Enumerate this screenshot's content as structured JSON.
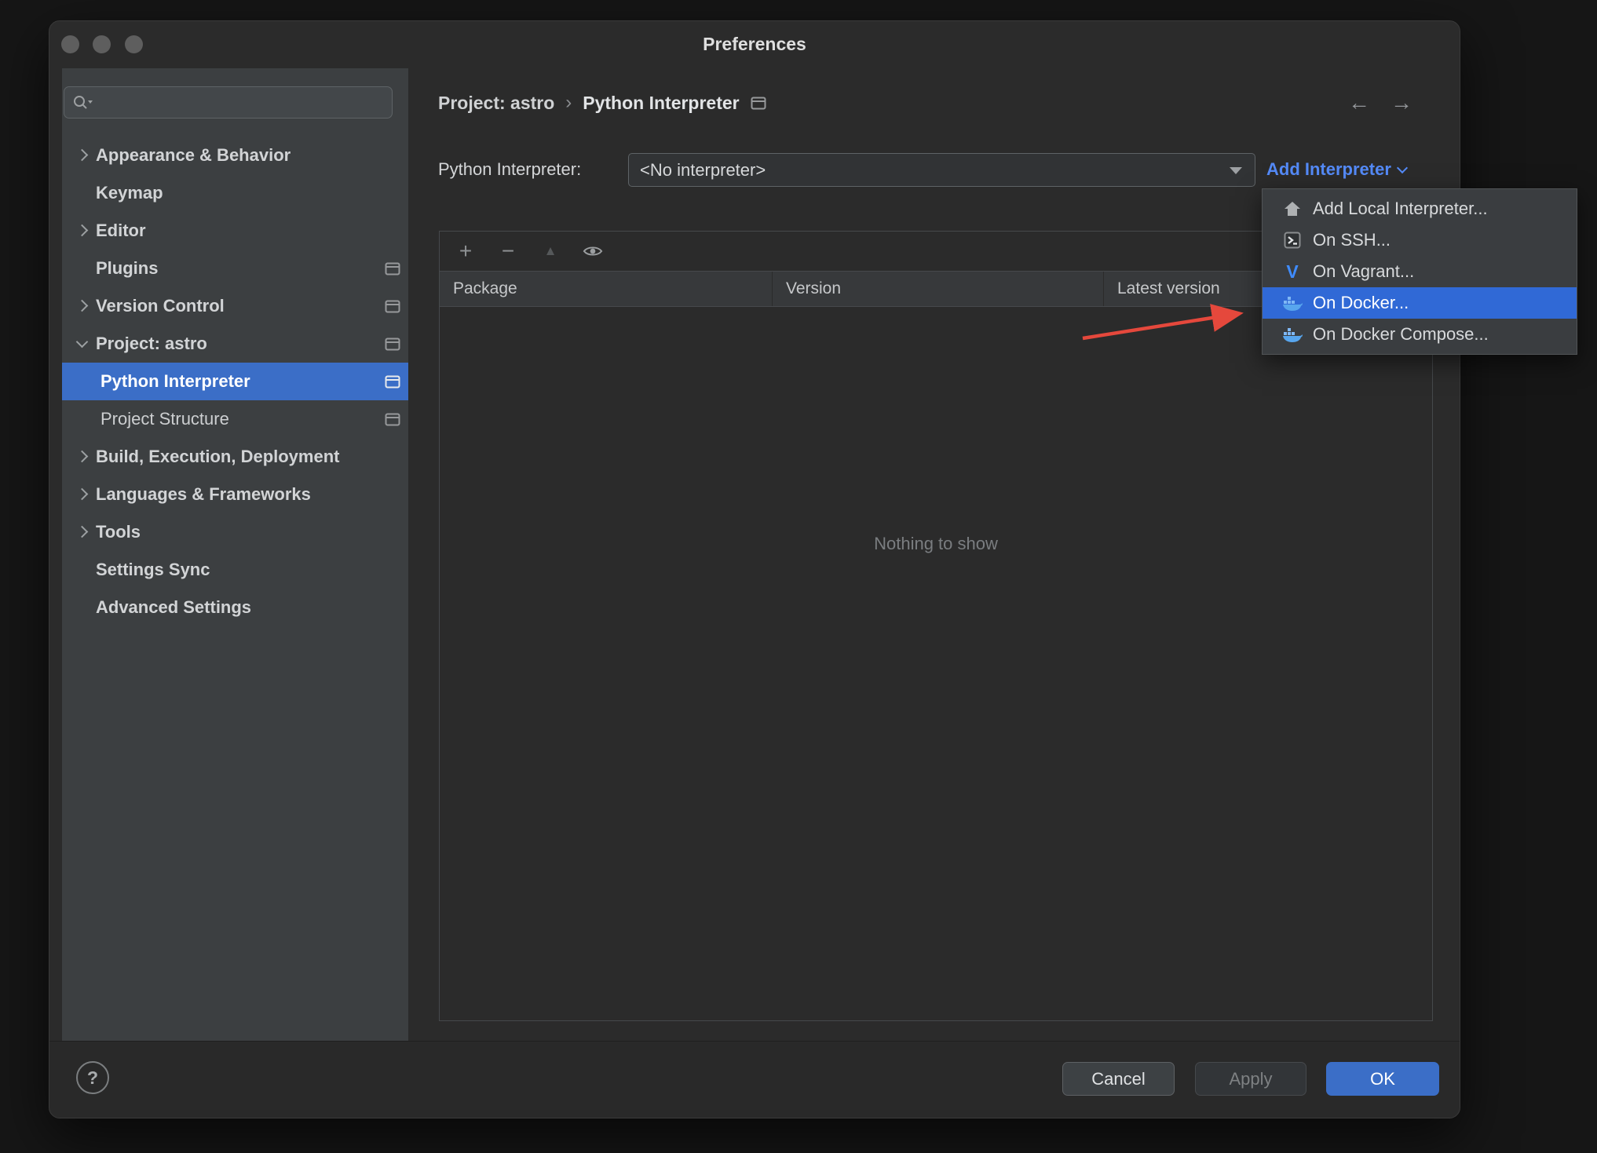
{
  "window": {
    "title": "Preferences"
  },
  "sidebar": {
    "items": [
      {
        "label": "Appearance & Behavior"
      },
      {
        "label": "Keymap"
      },
      {
        "label": "Editor"
      },
      {
        "label": "Plugins"
      },
      {
        "label": "Version Control"
      },
      {
        "label": "Project: astro"
      },
      {
        "label": "Python Interpreter"
      },
      {
        "label": "Project Structure"
      },
      {
        "label": "Build, Execution, Deployment"
      },
      {
        "label": "Languages & Frameworks"
      },
      {
        "label": "Tools"
      },
      {
        "label": "Settings Sync"
      },
      {
        "label": "Advanced Settings"
      }
    ]
  },
  "breadcrumb": {
    "project": "Project: astro",
    "separator": "›",
    "page": "Python Interpreter"
  },
  "main": {
    "interpreter_label": "Python Interpreter:",
    "interpreter_value": "<No interpreter>",
    "add_interpreter_label": "Add Interpreter"
  },
  "add_menu": {
    "items": [
      {
        "label": "Add Local Interpreter..."
      },
      {
        "label": "On SSH..."
      },
      {
        "label": "On Vagrant..."
      },
      {
        "label": "On Docker..."
      },
      {
        "label": "On Docker Compose..."
      }
    ]
  },
  "packages": {
    "columns": [
      "Package",
      "Version",
      "Latest version"
    ],
    "empty_text": "Nothing to show"
  },
  "footer": {
    "cancel": "Cancel",
    "apply": "Apply",
    "ok": "OK",
    "help": "?"
  },
  "icons": {
    "plus": "+",
    "minus": "−",
    "move_up": "▲",
    "back": "←",
    "forward": "→",
    "vagrant": "V"
  },
  "colors": {
    "selection_blue": "#3B6EC7",
    "menu_selection_blue": "#3069D6",
    "link_blue": "#548AF7",
    "ok_button_blue": "#3B6EC7",
    "arrow_red": "#E5483C",
    "docker_blue": "#2396ED"
  }
}
